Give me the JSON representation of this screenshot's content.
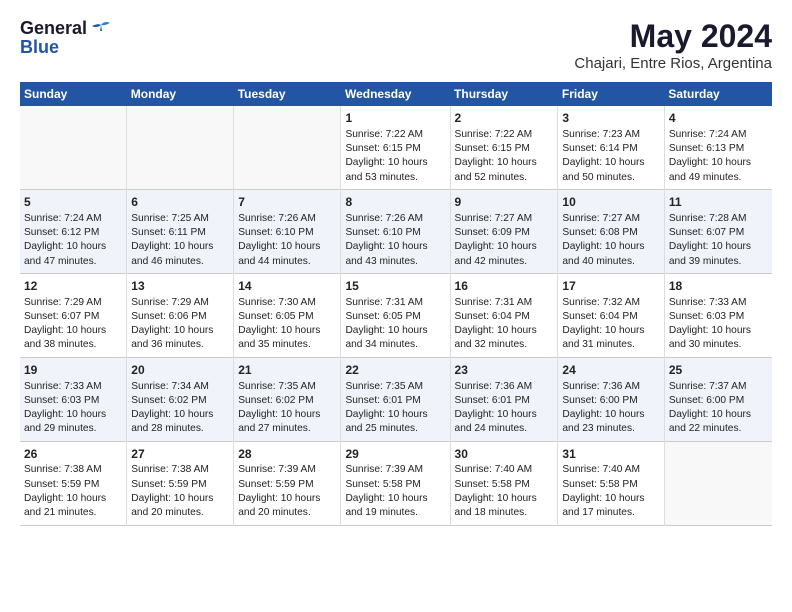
{
  "header": {
    "logo_general": "General",
    "logo_blue": "Blue",
    "month_year": "May 2024",
    "location": "Chajari, Entre Rios, Argentina"
  },
  "days_of_week": [
    "Sunday",
    "Monday",
    "Tuesday",
    "Wednesday",
    "Thursday",
    "Friday",
    "Saturday"
  ],
  "weeks": [
    [
      {
        "day": "",
        "content": ""
      },
      {
        "day": "",
        "content": ""
      },
      {
        "day": "",
        "content": ""
      },
      {
        "day": "1",
        "content": "Sunrise: 7:22 AM\nSunset: 6:15 PM\nDaylight: 10 hours\nand 53 minutes."
      },
      {
        "day": "2",
        "content": "Sunrise: 7:22 AM\nSunset: 6:15 PM\nDaylight: 10 hours\nand 52 minutes."
      },
      {
        "day": "3",
        "content": "Sunrise: 7:23 AM\nSunset: 6:14 PM\nDaylight: 10 hours\nand 50 minutes."
      },
      {
        "day": "4",
        "content": "Sunrise: 7:24 AM\nSunset: 6:13 PM\nDaylight: 10 hours\nand 49 minutes."
      }
    ],
    [
      {
        "day": "5",
        "content": "Sunrise: 7:24 AM\nSunset: 6:12 PM\nDaylight: 10 hours\nand 47 minutes."
      },
      {
        "day": "6",
        "content": "Sunrise: 7:25 AM\nSunset: 6:11 PM\nDaylight: 10 hours\nand 46 minutes."
      },
      {
        "day": "7",
        "content": "Sunrise: 7:26 AM\nSunset: 6:10 PM\nDaylight: 10 hours\nand 44 minutes."
      },
      {
        "day": "8",
        "content": "Sunrise: 7:26 AM\nSunset: 6:10 PM\nDaylight: 10 hours\nand 43 minutes."
      },
      {
        "day": "9",
        "content": "Sunrise: 7:27 AM\nSunset: 6:09 PM\nDaylight: 10 hours\nand 42 minutes."
      },
      {
        "day": "10",
        "content": "Sunrise: 7:27 AM\nSunset: 6:08 PM\nDaylight: 10 hours\nand 40 minutes."
      },
      {
        "day": "11",
        "content": "Sunrise: 7:28 AM\nSunset: 6:07 PM\nDaylight: 10 hours\nand 39 minutes."
      }
    ],
    [
      {
        "day": "12",
        "content": "Sunrise: 7:29 AM\nSunset: 6:07 PM\nDaylight: 10 hours\nand 38 minutes."
      },
      {
        "day": "13",
        "content": "Sunrise: 7:29 AM\nSunset: 6:06 PM\nDaylight: 10 hours\nand 36 minutes."
      },
      {
        "day": "14",
        "content": "Sunrise: 7:30 AM\nSunset: 6:05 PM\nDaylight: 10 hours\nand 35 minutes."
      },
      {
        "day": "15",
        "content": "Sunrise: 7:31 AM\nSunset: 6:05 PM\nDaylight: 10 hours\nand 34 minutes."
      },
      {
        "day": "16",
        "content": "Sunrise: 7:31 AM\nSunset: 6:04 PM\nDaylight: 10 hours\nand 32 minutes."
      },
      {
        "day": "17",
        "content": "Sunrise: 7:32 AM\nSunset: 6:04 PM\nDaylight: 10 hours\nand 31 minutes."
      },
      {
        "day": "18",
        "content": "Sunrise: 7:33 AM\nSunset: 6:03 PM\nDaylight: 10 hours\nand 30 minutes."
      }
    ],
    [
      {
        "day": "19",
        "content": "Sunrise: 7:33 AM\nSunset: 6:03 PM\nDaylight: 10 hours\nand 29 minutes."
      },
      {
        "day": "20",
        "content": "Sunrise: 7:34 AM\nSunset: 6:02 PM\nDaylight: 10 hours\nand 28 minutes."
      },
      {
        "day": "21",
        "content": "Sunrise: 7:35 AM\nSunset: 6:02 PM\nDaylight: 10 hours\nand 27 minutes."
      },
      {
        "day": "22",
        "content": "Sunrise: 7:35 AM\nSunset: 6:01 PM\nDaylight: 10 hours\nand 25 minutes."
      },
      {
        "day": "23",
        "content": "Sunrise: 7:36 AM\nSunset: 6:01 PM\nDaylight: 10 hours\nand 24 minutes."
      },
      {
        "day": "24",
        "content": "Sunrise: 7:36 AM\nSunset: 6:00 PM\nDaylight: 10 hours\nand 23 minutes."
      },
      {
        "day": "25",
        "content": "Sunrise: 7:37 AM\nSunset: 6:00 PM\nDaylight: 10 hours\nand 22 minutes."
      }
    ],
    [
      {
        "day": "26",
        "content": "Sunrise: 7:38 AM\nSunset: 5:59 PM\nDaylight: 10 hours\nand 21 minutes."
      },
      {
        "day": "27",
        "content": "Sunrise: 7:38 AM\nSunset: 5:59 PM\nDaylight: 10 hours\nand 20 minutes."
      },
      {
        "day": "28",
        "content": "Sunrise: 7:39 AM\nSunset: 5:59 PM\nDaylight: 10 hours\nand 20 minutes."
      },
      {
        "day": "29",
        "content": "Sunrise: 7:39 AM\nSunset: 5:58 PM\nDaylight: 10 hours\nand 19 minutes."
      },
      {
        "day": "30",
        "content": "Sunrise: 7:40 AM\nSunset: 5:58 PM\nDaylight: 10 hours\nand 18 minutes."
      },
      {
        "day": "31",
        "content": "Sunrise: 7:40 AM\nSunset: 5:58 PM\nDaylight: 10 hours\nand 17 minutes."
      },
      {
        "day": "",
        "content": ""
      }
    ]
  ]
}
